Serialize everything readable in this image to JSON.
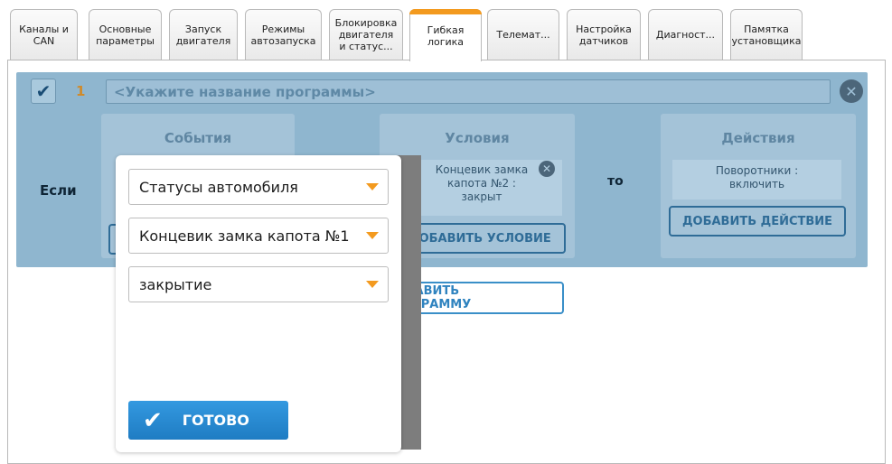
{
  "tabs": [
    {
      "label": "Каналы и\nCAN"
    },
    {
      "label": "Основные\nпараметры"
    },
    {
      "label": "Запуск\nдвигателя"
    },
    {
      "label": "Режимы\nавтозапуска"
    },
    {
      "label": "Блокировка\nдвигателя\nи статус..."
    },
    {
      "label": "Гибкая\nлогика",
      "active": true
    },
    {
      "label": "Телемат..."
    },
    {
      "label": "Настройка\nдатчиков"
    },
    {
      "label": "Диагност..."
    },
    {
      "label": "Памятка\nустановщика"
    }
  ],
  "colors": {
    "accent_orange": "#f39a1f",
    "primary_blue": "#1f7cc3",
    "overlay_blue": "#8fb6cf"
  },
  "program": {
    "number": "1",
    "name_placeholder": "<Укажите название программы>",
    "if_label": "Если",
    "then_label": "то",
    "events_title": "События",
    "conditions_title": "Условия",
    "actions_title": "Действия",
    "condition_chip": "Концевик замка\nкапота №2 :\nзакрыт",
    "action_chip": "Поворотники :\nвключить",
    "add_condition_label": "ДОБАВИТЬ УСЛОВИЕ",
    "add_action_label": "ДОБАВИТЬ ДЕЙСТВИЕ"
  },
  "add_program_label": "ДОБАВИТЬ ПРОГРАММУ",
  "modal": {
    "select_category": "Статусы автомобиля",
    "select_sensor": "Концевик замка капота №1",
    "select_state": "закрытие",
    "done_label": "ГОТОВО"
  }
}
